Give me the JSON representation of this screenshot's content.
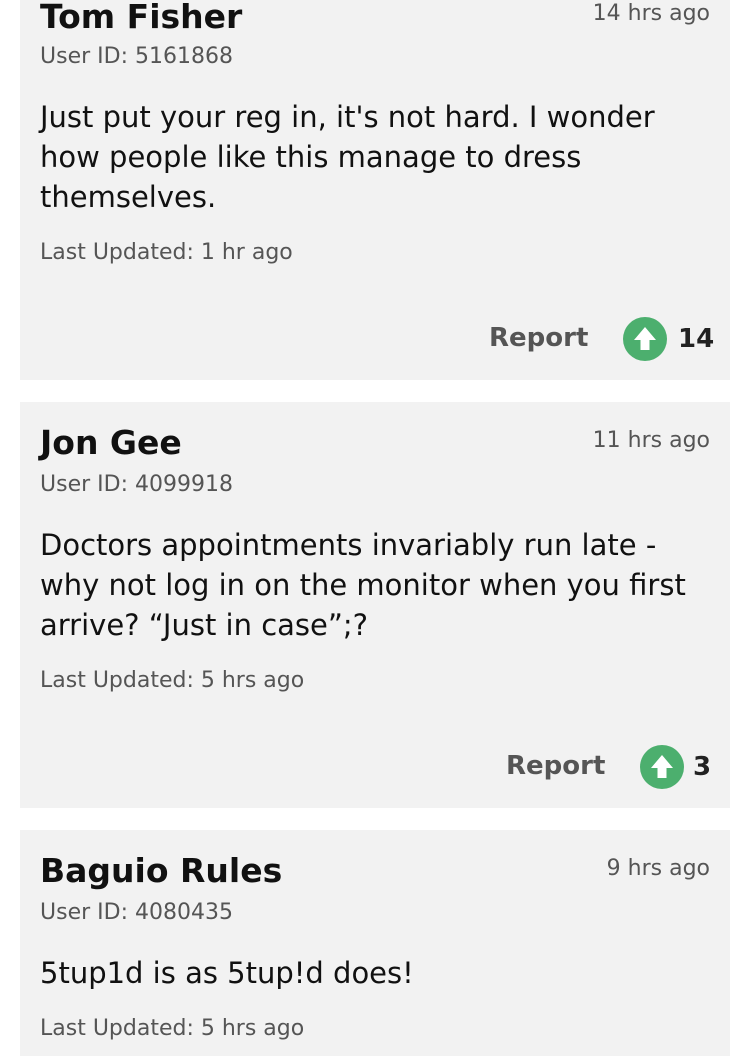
{
  "comments": [
    {
      "author": "Tom Fisher",
      "time": "14 hrs ago",
      "user_id": "User ID: 5161868",
      "body": "Just put your reg in, it's not hard. I wonder how people like this manage to dress themselves.",
      "updated": "Last Updated: 1 hr ago",
      "report_label": "Report",
      "upvotes": "14"
    },
    {
      "author": "Jon Gee",
      "time": "11 hrs ago",
      "user_id": "User ID: 4099918",
      "body": "Doctors appointments invariably run late - why not log in on the monitor when you first arrive? “Just in case”;?",
      "updated": "Last Updated: 5 hrs ago",
      "report_label": "Report",
      "upvotes": "3"
    },
    {
      "author": "Baguio Rules",
      "time": "9 hrs ago",
      "user_id": "User ID: 4080435",
      "body": "5tup1d is as 5tup!d does!",
      "updated": "Last Updated: 5 hrs ago"
    }
  ],
  "colors": {
    "card_bg": "#f2f2f2",
    "upvote": "#4caf6e",
    "muted_text": "#555555"
  },
  "icons": {
    "upvote": "arrow-up-circle-icon"
  }
}
